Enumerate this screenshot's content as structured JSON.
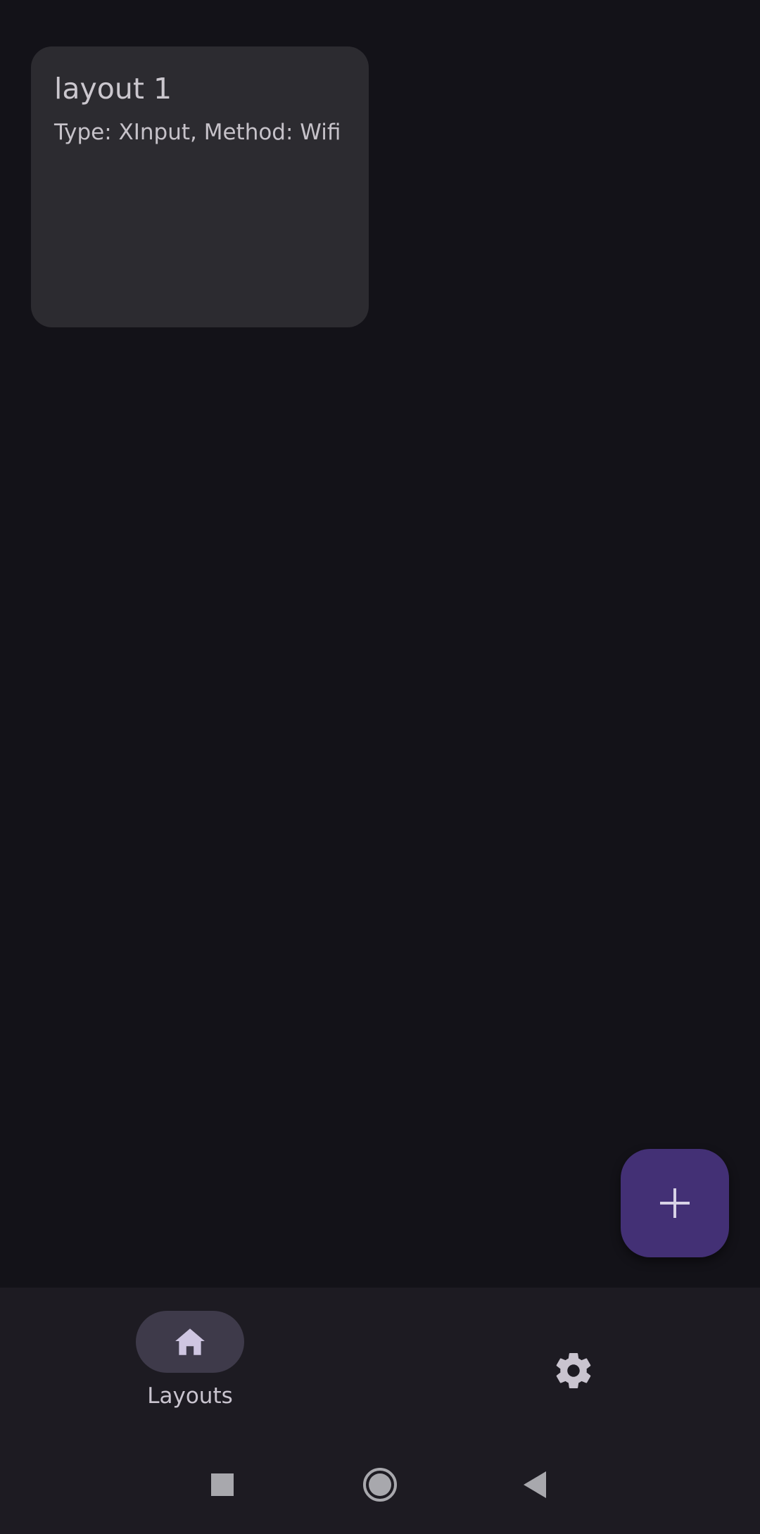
{
  "cards": [
    {
      "title": "layout 1",
      "subtitle": "Type: XInput, Method: Wifi"
    }
  ],
  "fab": {
    "icon": "plus-icon"
  },
  "bottom_nav": {
    "items": [
      {
        "label": "Layouts",
        "icon": "home-icon",
        "selected": true
      },
      {
        "label": "",
        "icon": "gear-icon",
        "selected": false
      }
    ]
  },
  "system_nav": {
    "recent": "square-icon",
    "home": "circle-icon",
    "back": "triangle-back-icon"
  },
  "colors": {
    "background": "#131218",
    "card": "#2c2b30",
    "fab": "#433075",
    "nav_bar": "#1d1b22",
    "nav_pill": "#3e3a4a",
    "icon_tint": "#c9c4cf"
  }
}
